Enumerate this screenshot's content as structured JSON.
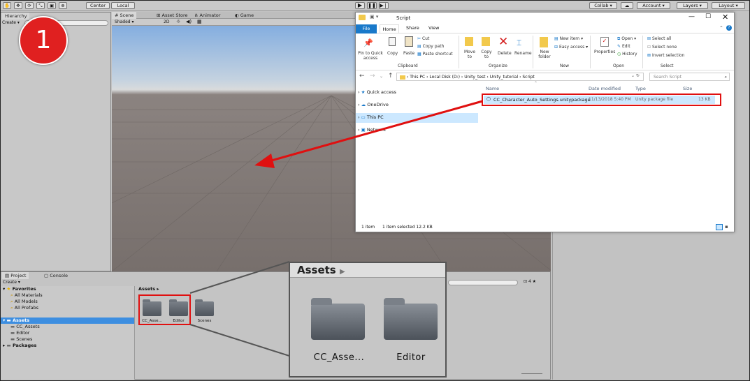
{
  "step_number": "1",
  "toolbar": {
    "pivot_label": "Center",
    "space_label": "Local",
    "collab_label": "Collab",
    "account_label": "Account",
    "layers_label": "Layers",
    "layout_label": "Layout"
  },
  "hierarchy": {
    "tab_label": "Hierarchy",
    "create_label": "Create"
  },
  "scene_tabs": {
    "scene": "Scene",
    "asset_store": "Asset Store",
    "animator": "Animator",
    "game": "Game"
  },
  "scene_toolbar": {
    "shading": "Shaded",
    "mode_2d": "2D"
  },
  "project": {
    "tab_project": "Project",
    "tab_console": "Console",
    "create_label": "Create",
    "favorites_label": "Favorites",
    "favorites": [
      "All Materials",
      "All Models",
      "All Prefabs"
    ],
    "assets_label": "Assets",
    "asset_folders": [
      "CC_Assets",
      "Editor",
      "Scenes"
    ],
    "packages_label": "Packages",
    "breadcrumb": "Assets",
    "grid_items": [
      "CC_Asse...",
      "Editor",
      "Scenes"
    ],
    "counter": "4"
  },
  "zoom_callout": {
    "header": "Assets",
    "items": [
      "CC_Asse...",
      "Editor"
    ]
  },
  "explorer": {
    "title": "Script",
    "ribbon_tabs": [
      "File",
      "Home",
      "Share",
      "View"
    ],
    "clipboard": {
      "pin_label": "Pin to Quick access",
      "copy_label": "Copy",
      "paste_label": "Paste",
      "cut_label": "Cut",
      "copy_path_label": "Copy path",
      "paste_shortcut_label": "Paste shortcut",
      "group_label": "Clipboard"
    },
    "organize": {
      "move_label": "Move to",
      "copy_to_label": "Copy to",
      "delete_label": "Delete",
      "rename_label": "Rename",
      "group_label": "Organize"
    },
    "new_group": {
      "new_item_label": "New item",
      "easy_access_label": "Easy access",
      "new_folder_label": "New folder",
      "group_label": "New"
    },
    "open_group": {
      "properties_label": "Properties",
      "open_label": "Open",
      "edit_label": "Edit",
      "history_label": "History",
      "group_label": "Open"
    },
    "select_group": {
      "select_all_label": "Select all",
      "select_none_label": "Select none",
      "invert_label": "Invert selection",
      "group_label": "Select"
    },
    "address_path": [
      "This PC",
      "Local Disk (D:)",
      "Unity_test",
      "Unity_tutorial",
      "Script"
    ],
    "search_placeholder": "Search Script",
    "nav_items": [
      "Quick access",
      "OneDrive",
      "This PC",
      "Network"
    ],
    "columns": [
      "Name",
      "Date modified",
      "Type",
      "Size"
    ],
    "file": {
      "name": "CC_Character_Auto_Settings.unitypackage",
      "date": "11/13/2018 5:40 PM",
      "type": "Unity package file",
      "size": "13 KB"
    },
    "status_count": "1 item",
    "status_selected": "1 item selected  12.2 KB"
  },
  "colors": {
    "accent_red": "#e01010",
    "badge_red": "#e02020",
    "explorer_blue": "#1979ca",
    "selection_blue": "#cce8ff"
  }
}
